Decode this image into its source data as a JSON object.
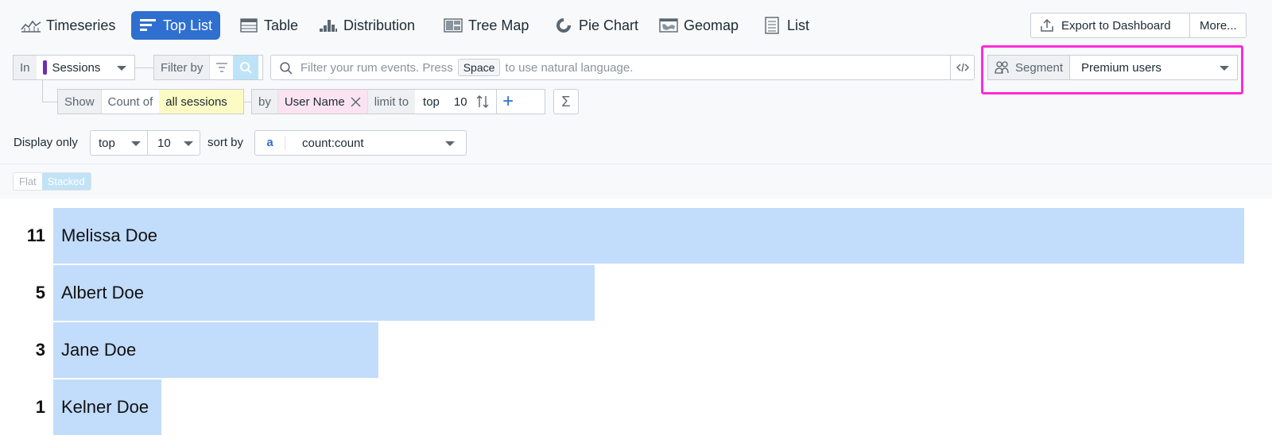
{
  "viz_tabs": [
    {
      "label": "Timeseries",
      "icon": "timeseries-icon",
      "active": false
    },
    {
      "label": "Top List",
      "icon": "toplist-icon",
      "active": true
    },
    {
      "label": "Table",
      "icon": "table-icon",
      "active": false
    },
    {
      "label": "Distribution",
      "icon": "distribution-icon",
      "active": false
    },
    {
      "label": "Tree Map",
      "icon": "treemap-icon",
      "active": false
    },
    {
      "label": "Pie Chart",
      "icon": "piechart-icon",
      "active": false
    },
    {
      "label": "Geomap",
      "icon": "geomap-icon",
      "active": false
    },
    {
      "label": "List",
      "icon": "list-icon",
      "active": false
    }
  ],
  "actions": {
    "export_label": "Export to Dashboard",
    "more_label": "More..."
  },
  "query": {
    "in_label": "In",
    "source": "Sessions",
    "filter_by_label": "Filter by",
    "search_placeholder_pre": "Filter your rum events. Press",
    "search_key": "Space",
    "search_placeholder_post": "to use natural language.",
    "segment_label": "Segment",
    "segment_value": "Premium users",
    "show_label": "Show",
    "count_of_label": "Count of",
    "measure": "all sessions",
    "by_label": "by",
    "group_by": "User Name",
    "limit_to_label": "limit to",
    "limit_dir": "top",
    "limit_num": "10",
    "add_symbol": "+",
    "sigma_symbol": "Σ"
  },
  "display": {
    "display_only_label": "Display only",
    "top_value": "top",
    "num_value": "10",
    "sort_by_label": "sort by",
    "sort_query_letter": "a",
    "sort_field": "count:count"
  },
  "stack_toggle": {
    "flat_label": "Flat",
    "stacked_label": "Stacked",
    "active": "Stacked"
  },
  "colors": {
    "accent": "#2f6fd0",
    "bar": "#c2dcfb",
    "highlight": "#ff2bd6",
    "measure_bg": "#fdfbc4",
    "group_bg": "#fbe3f1",
    "source_marker": "#6b2fb3"
  },
  "chart_data": {
    "type": "bar",
    "orientation": "horizontal",
    "categories": [
      "Melissa Doe",
      "Albert Doe",
      "Jane Doe",
      "Kelner Doe"
    ],
    "values": [
      11,
      5,
      3,
      1
    ],
    "xlim": [
      0,
      11
    ]
  }
}
